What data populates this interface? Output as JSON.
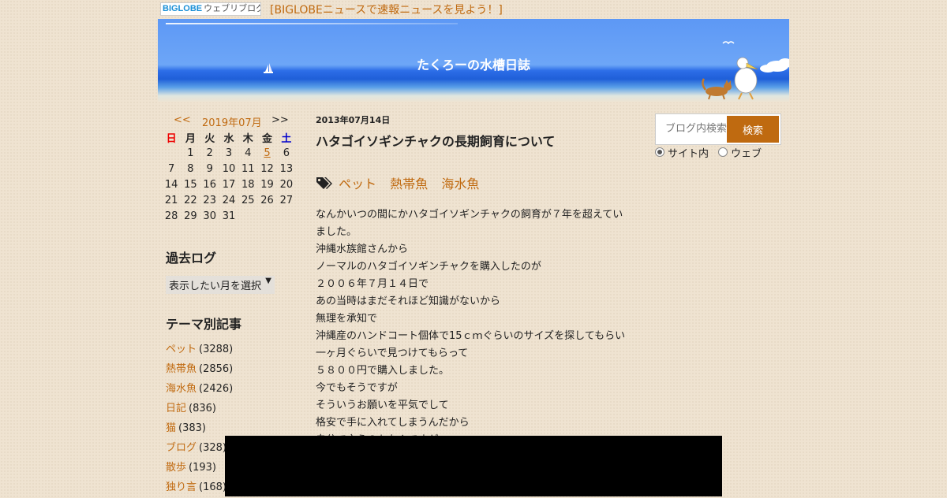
{
  "topbar": {
    "logo_brand": "BIGLOBE",
    "logo_service": "ウェブリブログ",
    "news_link": "[BIGLOBEニュースで速報ニュースを見よう！]"
  },
  "banner": {
    "title": "たくろーの水槽日誌"
  },
  "calendar": {
    "prev": "<<",
    "month": "2019年07月",
    "next": ">>",
    "weekdays": [
      "日",
      "月",
      "火",
      "水",
      "木",
      "金",
      "土"
    ],
    "linked_day": "5",
    "weeks": [
      [
        "",
        "1",
        "2",
        "3",
        "4",
        "5",
        "6"
      ],
      [
        "7",
        "8",
        "9",
        "10",
        "11",
        "12",
        "13"
      ],
      [
        "14",
        "15",
        "16",
        "17",
        "18",
        "19",
        "20"
      ],
      [
        "21",
        "22",
        "23",
        "24",
        "25",
        "26",
        "27"
      ],
      [
        "28",
        "29",
        "30",
        "31",
        "",
        "",
        ""
      ]
    ]
  },
  "archive": {
    "heading": "過去ログ",
    "select_label": "表示したい月を選択"
  },
  "themes": {
    "heading": "テーマ別記事",
    "items": [
      {
        "label": "ペット",
        "count": "(3288)"
      },
      {
        "label": "熱帯魚",
        "count": "(2856)"
      },
      {
        "label": "海水魚",
        "count": "(2426)"
      },
      {
        "label": "日記",
        "count": "(836)"
      },
      {
        "label": "猫",
        "count": "(383)"
      },
      {
        "label": "ブログ",
        "count": "(328)"
      },
      {
        "label": "散歩",
        "count": "(193)"
      },
      {
        "label": "独り言",
        "count": "(168)"
      }
    ]
  },
  "post": {
    "date": "2013年07月14日",
    "title": "ハタゴイソギンチャクの長期飼育について",
    "tags": [
      "ペット",
      "熱帯魚",
      "海水魚"
    ],
    "body": [
      "なんかいつの間にかハタゴイソギンチャクの飼育が７年を超えていました。",
      "沖縄水族館さんから",
      "ノーマルのハタゴイソギンチャクを購入したのが",
      "２００６年７月１４日で",
      "あの当時はまだそれほど知識がないから",
      "無理を承知で",
      "沖縄産のハンドコート個体で15ｃｍぐらいのサイズを探してもらい",
      "一ヶ月ぐらいで見つけてもらって",
      "５８００円で購入しました。",
      "今でもそうですが",
      "そういうお願いを平気でして",
      "格安で手に入れてしまうんだから",
      "自分で言うのもなんですが"
    ]
  },
  "search": {
    "placeholder": "ブログ内検索",
    "button": "検索",
    "scope_site": "サイト内",
    "scope_web": "ウェブ"
  }
}
